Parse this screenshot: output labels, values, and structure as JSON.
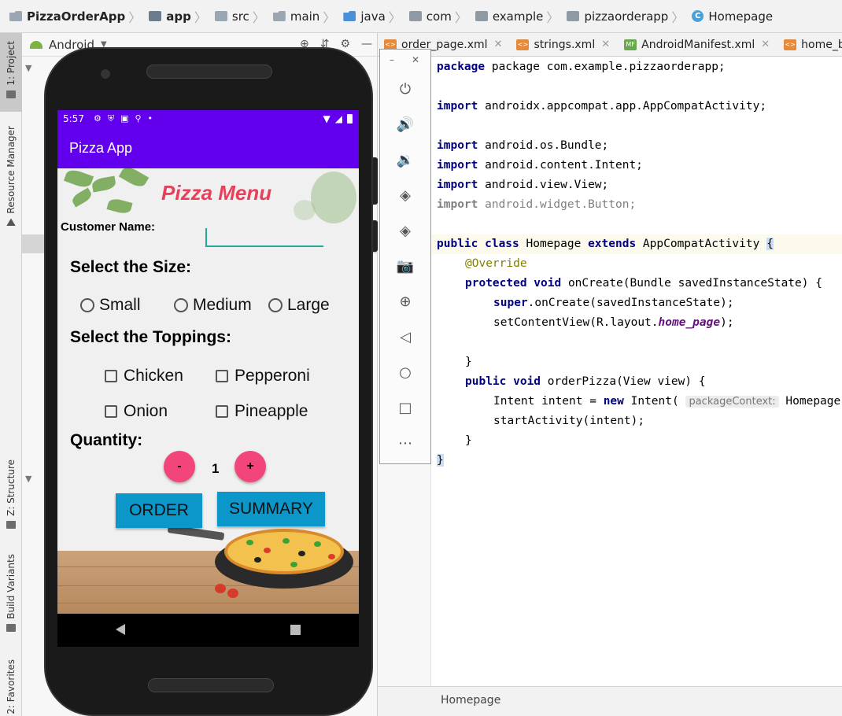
{
  "breadcrumb": [
    "PizzaOrderApp",
    "app",
    "src",
    "main",
    "java",
    "com",
    "example",
    "pizzaorderapp",
    "Homepage"
  ],
  "left_tabs": [
    "1: Project",
    "Resource Manager",
    "Z: Structure",
    "Build Variants",
    "2: Favorites"
  ],
  "project_panel": {
    "view_mode": "Android"
  },
  "editor_tabs": [
    {
      "label": "order_page.xml",
      "icon": "xml-file-icon"
    },
    {
      "label": "strings.xml",
      "icon": "xml-file-icon"
    },
    {
      "label": "AndroidManifest.xml",
      "icon": "manifest-file-icon"
    },
    {
      "label": "home_bu",
      "icon": "xml-file-icon"
    }
  ],
  "code": {
    "l1": "package com.example.pizzaorderapp;",
    "imp1": "androidx.appcompat.app.AppCompatActivity;",
    "imp2": "android.os.Bundle;",
    "imp3": "android.content.Intent;",
    "imp4": "android.view.View;",
    "imp5": "android.widget.Button;",
    "cls_name": "Homepage",
    "cls_parent": "AppCompatActivity",
    "override": "@Override",
    "oncreate": "onCreate(Bundle savedInstanceState) {",
    "super_call": ".onCreate(savedInstanceState);",
    "setcontent_a": "setContentView(R.layout.",
    "setcontent_field": "home_page",
    "setcontent_b": ");",
    "orderpizza": "orderPizza(View view) {",
    "intent_a": "Intent intent = ",
    "intent_b": " Intent(",
    "intent_hint": "packageContext:",
    "intent_c": " Homepage",
    "start": "startActivity(intent);"
  },
  "status_tab": "Homepage",
  "emulator_toolbar": [
    "power-icon",
    "volume-up-icon",
    "volume-down-icon",
    "rotate-left-icon",
    "rotate-right-icon",
    "camera-icon",
    "zoom-icon",
    "back-icon",
    "home-icon",
    "overview-icon",
    "more-icon"
  ],
  "app": {
    "status_time": "5:57",
    "app_title": "Pizza App",
    "menu_title": "Pizza Menu",
    "customer_label": "Customer Name:",
    "customer_value": "",
    "size_heading": "Select the Size:",
    "sizes": [
      "Small",
      "Medium",
      "Large"
    ],
    "toppings_heading": "Select the Toppings:",
    "toppings": [
      "Chicken",
      "Pepperoni",
      "Onion",
      "Pineapple"
    ],
    "quantity_label": "Quantity:",
    "quantity": "1",
    "minus": "-",
    "plus": "+",
    "order_btn": "ORDER",
    "summary_btn": "SUMMARY"
  },
  "colors": {
    "app_bar": "#6200ee",
    "title": "#e8405a",
    "round_btn": "#f2467a",
    "action_btn": "#0b97c9",
    "input_underline": "#26a69a"
  }
}
